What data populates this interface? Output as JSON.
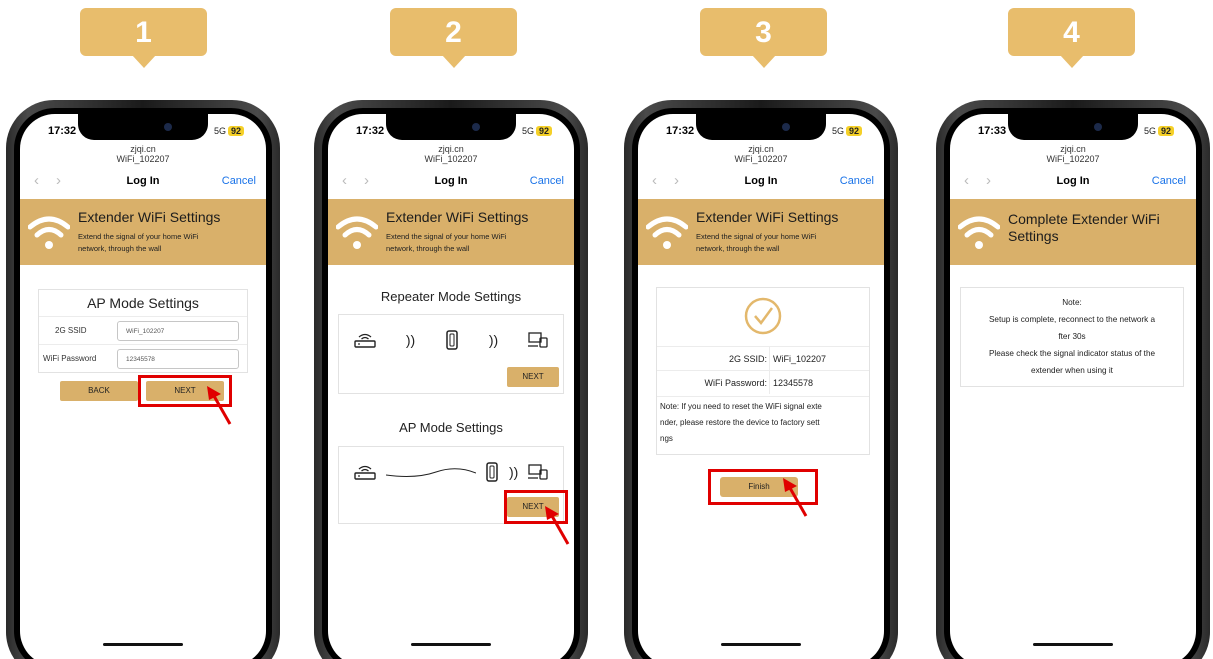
{
  "steps": [
    {
      "number": "1"
    },
    {
      "number": "2"
    },
    {
      "number": "3"
    },
    {
      "number": "4"
    }
  ],
  "status": {
    "time_a": "17:32",
    "time_b": "17:33",
    "network": "5G",
    "battery": "92"
  },
  "browser": {
    "host": "zjqi.cn",
    "page_name": "WiFi_102207",
    "title": "Log In",
    "cancel": "Cancel",
    "back_glyph": "‹",
    "fwd_glyph": "›"
  },
  "banner": {
    "title": "Extender WiFi Settings",
    "subtitle_1": "Extend the signal of your home WiFi",
    "subtitle_2": "network, through the wall",
    "complete_title": "Complete Extender WiFi Settings"
  },
  "screen1": {
    "heading": "AP Mode Settings",
    "ssid_label": "2G SSID",
    "ssid_value": "WiFi_102207",
    "pwd_label": "WiFi Password",
    "pwd_value": "12345578",
    "back_label": "BACK",
    "next_label": "NEXT"
  },
  "screen2": {
    "repeater_heading": "Repeater Mode Settings",
    "ap_heading": "AP Mode Settings",
    "next_label": "NEXT"
  },
  "screen3": {
    "ssid_label": "2G SSID:",
    "ssid_value": "WiFi_102207",
    "pwd_label": "WiFi Password:",
    "pwd_value": "12345578",
    "note_1": "Note: If you need to reset the WiFi signal exte",
    "note_2": "nder, please restore the device to factory sett",
    "note_3": "ngs",
    "finish_label": "Finish"
  },
  "screen4": {
    "note_title": "Note:",
    "line_1": "Setup is complete, reconnect to the network a",
    "line_2": "fter 30s",
    "line_3": "Please check the signal indicator status of the",
    "line_4": "extender when using it"
  },
  "colors": {
    "accent": "#d9b06a",
    "badge": "#e8bd6c",
    "highlight": "#e00000",
    "link": "#1a73e8"
  },
  "icons": [
    "wifi-icon",
    "router-icon",
    "signal-icon",
    "extender-icon",
    "devices-icon",
    "check-circle-icon",
    "arrow-pointer-icon"
  ]
}
